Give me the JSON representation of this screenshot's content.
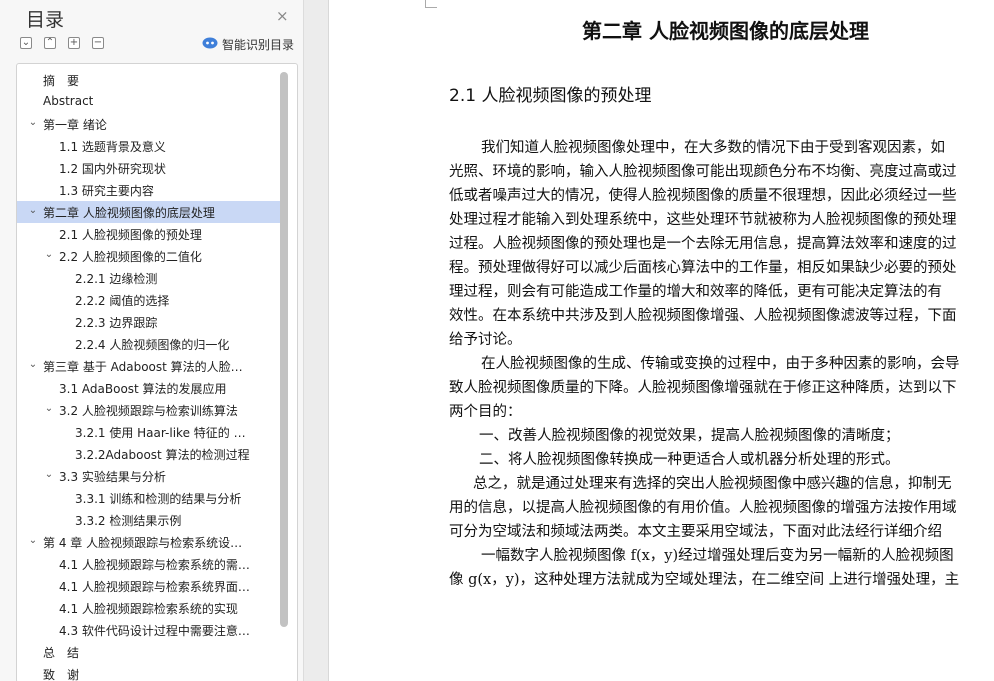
{
  "sidebar": {
    "title": "目录",
    "close_glyph": "×",
    "toolbar": [
      {
        "name": "collapse-all-button",
        "glyph": "⌄"
      },
      {
        "name": "expand-all-button",
        "glyph": "⌃"
      },
      {
        "name": "add-heading-button",
        "glyph": "+"
      },
      {
        "name": "remove-heading-button",
        "glyph": "−"
      }
    ],
    "smart_toc_label": "智能识别目录",
    "toc": [
      {
        "level": 0,
        "label": "摘　要",
        "chevron": false
      },
      {
        "level": 0,
        "label": "Abstract",
        "chevron": false
      },
      {
        "level": 0,
        "label": "第一章  绪论",
        "chevron": true
      },
      {
        "level": 1,
        "label": "1.1 选题背景及意义",
        "chevron": false
      },
      {
        "level": 1,
        "label": "1.2 国内外研究现状",
        "chevron": false
      },
      {
        "level": 1,
        "label": "1.3 研究主要内容",
        "chevron": false
      },
      {
        "level": 0,
        "label": "第二章  人脸视频图像的底层处理",
        "chevron": true,
        "selected": true
      },
      {
        "level": 1,
        "label": "2.1 人脸视频图像的预处理",
        "chevron": false
      },
      {
        "level": 1,
        "label": "2.2 人脸视频图像的二值化",
        "chevron": true
      },
      {
        "level": 2,
        "label": "2.2.1 边缘检测",
        "chevron": false
      },
      {
        "level": 2,
        "label": "2.2.2 阈值的选择",
        "chevron": false
      },
      {
        "level": 2,
        "label": "2.2.3 边界跟踪",
        "chevron": false
      },
      {
        "level": 2,
        "label": "2.2.4 人脸视频图像的归一化",
        "chevron": false
      },
      {
        "level": 0,
        "label": "第三章  基于 Adaboost 算法的人脸视频 ...",
        "chevron": true
      },
      {
        "level": 1,
        "label": "3.1 AdaBoost 算法的发展应用",
        "chevron": false
      },
      {
        "level": 1,
        "label": "3.2  人脸视频跟踪与检索训练算法",
        "chevron": true
      },
      {
        "level": 2,
        "label": "3.2.1 使用 Haar-like 特征的 Adab ...",
        "chevron": false
      },
      {
        "level": 2,
        "label": "3.2.2Adaboost 算法的检测过程",
        "chevron": false
      },
      {
        "level": 1,
        "label": "3.3 实验结果与分析",
        "chevron": true
      },
      {
        "level": 2,
        "label": "3.3.1 训练和检测的结果与分析",
        "chevron": false
      },
      {
        "level": 2,
        "label": "3.3.2 检测结果示例",
        "chevron": false
      },
      {
        "level": 0,
        "label": "第 4 章  人脸视频跟踪与检索系统设计与 ...",
        "chevron": true
      },
      {
        "level": 1,
        "label": "4.1 人脸视频跟踪与检索系统的需求概 ...",
        "chevron": false
      },
      {
        "level": 1,
        "label": "4.1 人脸视频跟踪与检索系统界面设计",
        "chevron": false
      },
      {
        "level": 1,
        "label": "4.1 人脸视频跟踪检索系统的实现",
        "chevron": false
      },
      {
        "level": 1,
        "label": "4.3 软件代码设计过程中需要注意的问 ...",
        "chevron": false
      },
      {
        "level": 0,
        "label": "总　结",
        "chevron": false
      },
      {
        "level": 0,
        "label": "致　谢",
        "chevron": false
      }
    ]
  },
  "document": {
    "chapter_title": "第二章  人脸视频图像的底层处理",
    "section_title": "2.1 人脸视频图像的预处理",
    "lines": [
      "我们知道人脸视频图像处理中，在大多数的情况下由于受到客观因素，如",
      "光照、环境的影响，输入人脸视频图像可能出现颜色分布不均衡、亮度过高或过",
      "低或者噪声过大的情况，使得人脸视频图像的质量不很理想，因此必须经过一些",
      "处理过程才能输入到处理系统中，这些处理环节就被称为人脸视频图像的预处理",
      "过程。人脸视频图像的预处理也是一个去除无用信息，提高算法效率和速度的过",
      "程。预处理做得好可以减少后面核心算法中的工作量，相反如果缺少必要的预处",
      "理过程，则会有可能造成工作量的增大和效率的降低，更有可能决定算法的有",
      "效性。在本系统中共涉及到人脸视频图像增强、人脸视频图像滤波等过程，下面",
      "给予讨论。",
      "在人脸视频图像的生成、传输或变换的过程中，由于多种因素的影响，会导",
      "致人脸视频图像质量的下降。人脸视频图像增强就在于修正这种降质，达到以下",
      "两个目的：",
      "一、改善人脸视频图像的视觉效果，提高人脸视频图像的清晰度；",
      "二、将人脸视频图像转换成一种更适合人或机器分析处理的形式。",
      "总之，就是通过处理来有选择的突出人脸视频图像中感兴趣的信息，抑制无",
      "用的信息，以提高人脸视频图像的有用价值。人脸视频图像的增强方法按作用域",
      "可分为空域法和频域法两类。本文主要采用空域法，下面对此法经行详细介绍",
      "一幅数字人脸视频图像 f(x，y)经过增强处理后变为另一幅新的人脸视频图",
      "像 g(x，y)，这种处理方法就成为空域处理法，在二维空间 上进行增强处理，主"
    ]
  },
  "colors": {
    "sidebar_bg": "#f7f7f7",
    "selected_row": "#c9d8f5",
    "smart_icon": "#3f7fd9"
  }
}
